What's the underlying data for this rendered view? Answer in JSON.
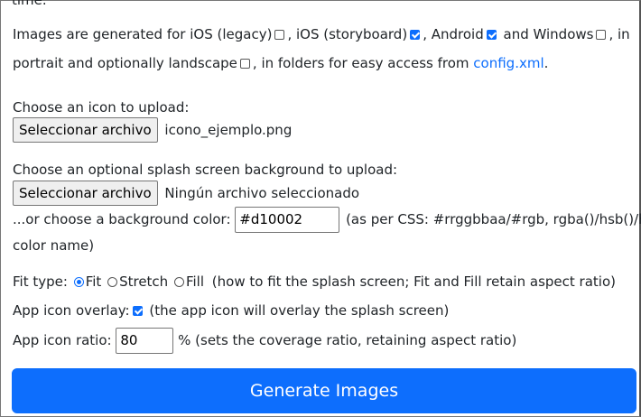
{
  "cut_top_text": "time.",
  "platforms": {
    "intro": "Images are generated for iOS (legacy)",
    "ios_storyboard": "iOS (storyboard)",
    "android": "Android",
    "windows": "and Windows",
    "in": "in",
    "portrait": "portrait and optionally landscape",
    "folders": "in folders for easy access from",
    "config_link": "config.xml",
    "checks": {
      "ios_legacy": false,
      "ios_storyboard": true,
      "android": true,
      "windows": false,
      "landscape": false
    }
  },
  "icon": {
    "label": "Choose an icon to upload:",
    "button": "Seleccionar archivo",
    "file": "icono_ejemplo.png"
  },
  "splash": {
    "label": "Choose an optional splash screen background to upload:",
    "button": "Seleccionar archivo",
    "file": "Ningún archivo seleccionado",
    "color_label": "...or choose a background color:",
    "color_value": "#d10002",
    "color_hint": "(as per CSS: #rrggbbaa/#rgb, rgba()/hsb()/hsl(),",
    "color_hint2": "color name)"
  },
  "fit": {
    "label": "Fit type:",
    "options": [
      "Fit",
      "Stretch",
      "Fill"
    ],
    "selected": "Fit",
    "hint": "(how to fit the splash screen; Fit and Fill retain aspect ratio)"
  },
  "overlay": {
    "label": "App icon overlay:",
    "checked": true,
    "hint": "(the app icon will overlay the splash screen)"
  },
  "ratio": {
    "label": "App icon ratio:",
    "value": "80",
    "hint": "% (sets the coverage ratio, retaining aspect ratio)"
  },
  "generate_button": "Generate Images",
  "colors": {
    "accent": "#0d6efd",
    "link": "#0d6efd"
  }
}
